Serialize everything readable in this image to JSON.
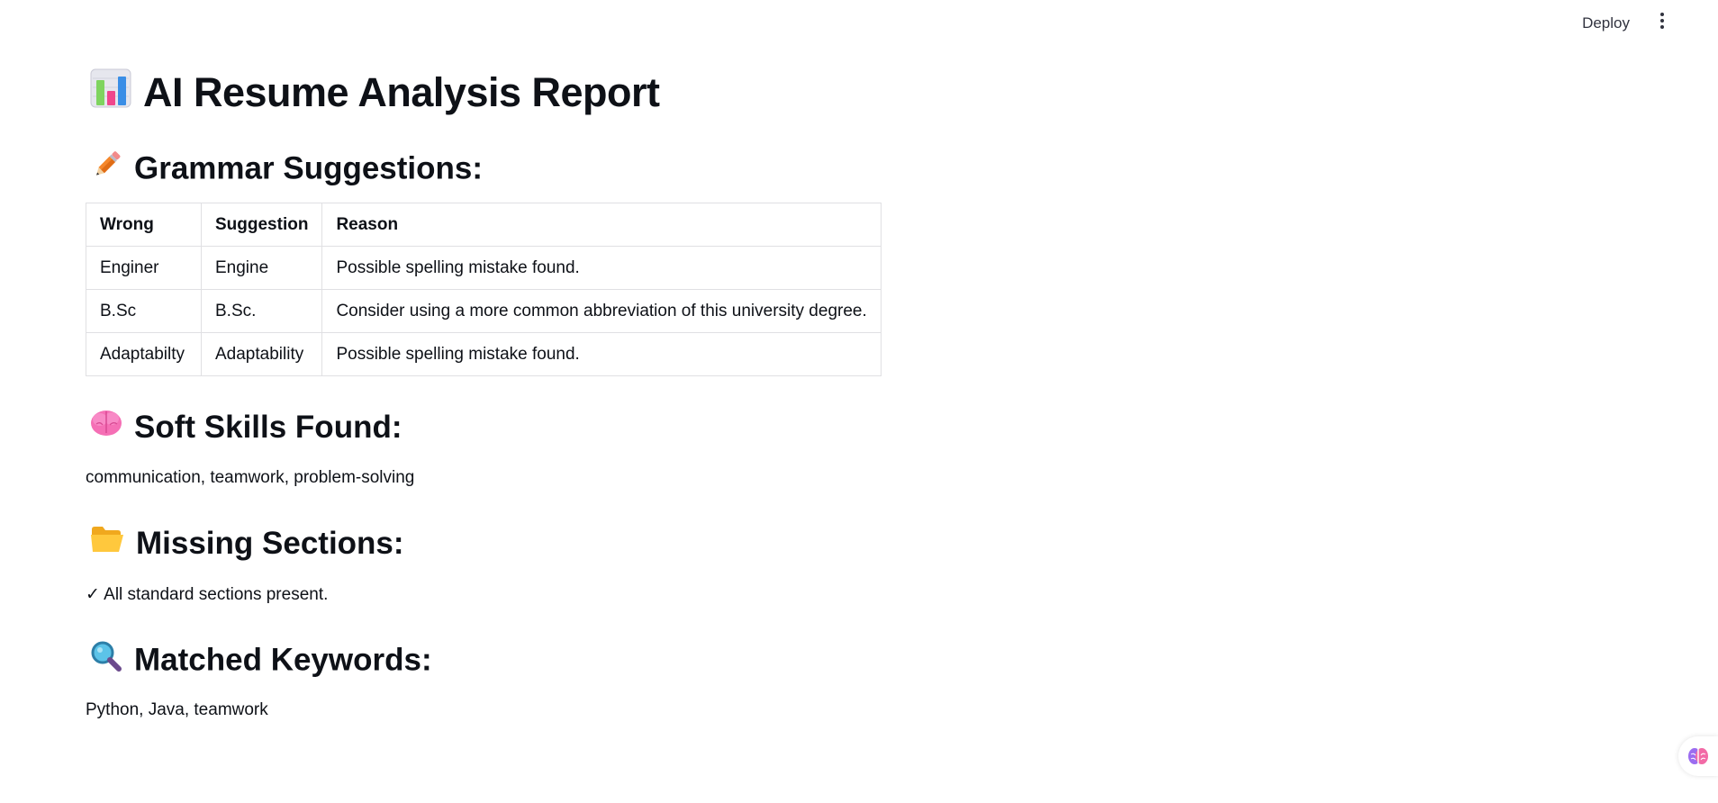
{
  "topbar": {
    "deploy_label": "Deploy",
    "menu_icon": "kebab-menu-icon"
  },
  "report": {
    "title": "AI Resume Analysis Report",
    "title_icon": "bar-chart-icon"
  },
  "grammar": {
    "heading": "Grammar Suggestions:",
    "icon": "pencil-icon",
    "columns": [
      "Wrong",
      "Suggestion",
      "Reason"
    ],
    "rows": [
      [
        "Enginer",
        "Engine",
        "Possible spelling mistake found."
      ],
      [
        "B.Sc",
        "B.Sc.",
        "Consider using a more common abbreviation of this university degree."
      ],
      [
        "Adaptabilty",
        "Adaptability",
        "Possible spelling mistake found."
      ]
    ]
  },
  "soft_skills": {
    "heading": "Soft Skills Found:",
    "icon": "brain-icon",
    "text": "communication, teamwork, problem-solving"
  },
  "missing_sections": {
    "heading": "Missing Sections:",
    "icon": "open-folder-icon",
    "text": "✓ All standard sections present."
  },
  "keywords": {
    "heading": "Matched Keywords:",
    "icon": "magnifier-icon",
    "text": "Python, Java, teamwork"
  },
  "floating": {
    "icon": "brain-icon"
  }
}
